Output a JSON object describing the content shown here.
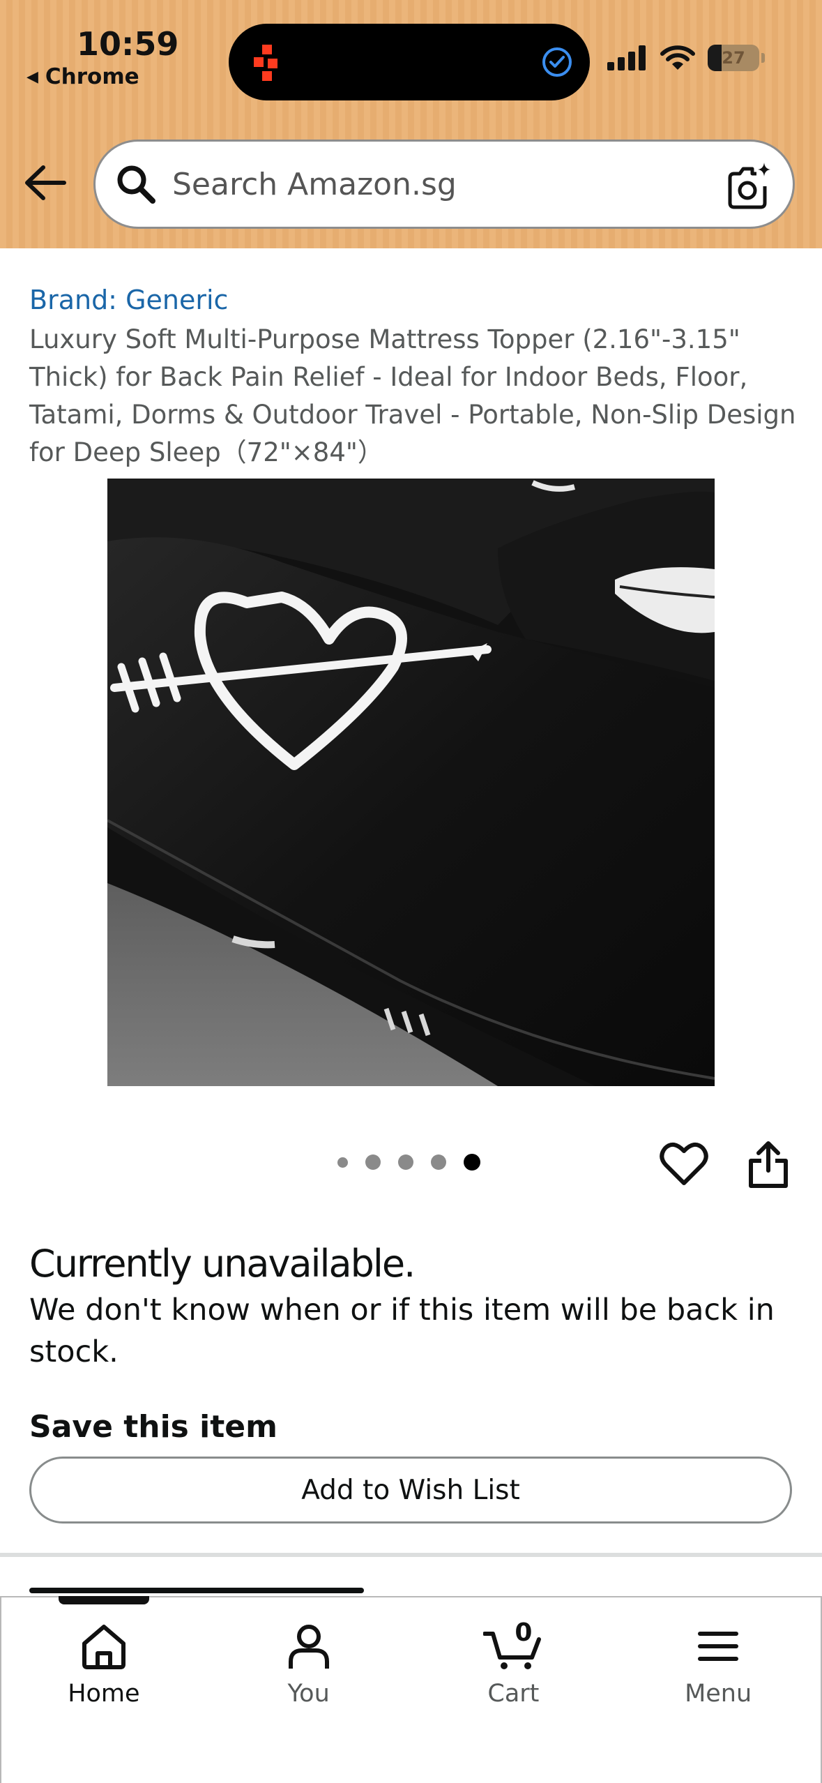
{
  "status_bar": {
    "time": "10:59",
    "back_app": "Chrome",
    "battery_level": "27",
    "battery_fraction": 0.27
  },
  "header": {
    "search_placeholder": "Search Amazon.sg",
    "icons": [
      "back-arrow-icon",
      "search-icon",
      "camera-sparkle-icon"
    ],
    "background_color": "#ebb57a"
  },
  "product": {
    "brand": "Brand: Generic",
    "title": "Luxury Soft Multi-Purpose Mattress Topper (2.16\"-3.15\" Thick) for Back Pain Relief - Ideal for Indoor Beds, Floor, Tatami, Dorms & Outdoor Travel - Portable, Non-Slip Design for Deep Sleep（72\"×84\"）",
    "image_count": 5,
    "active_image_index": 4
  },
  "availability": {
    "status": "Currently unavailable.",
    "message": "We don't know when or if this item will be back in stock."
  },
  "save": {
    "title": "Save this item",
    "button": "Add to Wish List"
  },
  "tabbar": {
    "items": [
      {
        "label": "Home",
        "icon": "home-icon",
        "active": true
      },
      {
        "label": "You",
        "icon": "person-icon",
        "active": false
      },
      {
        "label": "Cart",
        "icon": "cart-icon",
        "active": false
      },
      {
        "label": "Menu",
        "icon": "menu-icon",
        "active": false
      }
    ],
    "cart_count": "0"
  },
  "colors": {
    "link": "#1a66a8",
    "text": "#0f1111",
    "muted": "#565959"
  }
}
